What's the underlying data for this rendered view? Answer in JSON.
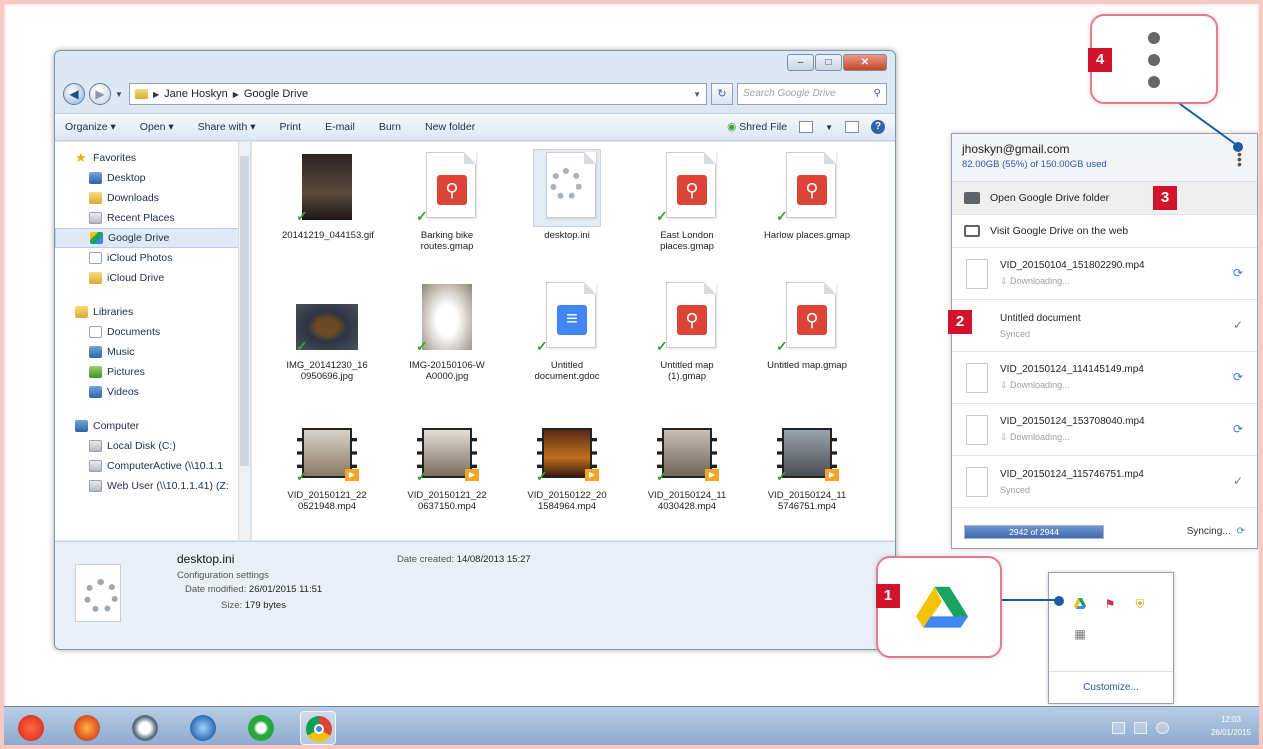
{
  "explorer": {
    "breadcrumb": [
      "Jane Hoskyn",
      "Google Drive"
    ],
    "search_placeholder": "Search Google Drive",
    "toolbar": [
      "Organize ▾",
      "Open ▾",
      "Share with ▾",
      "Print",
      "E-mail",
      "Burn",
      "New folder"
    ],
    "shred_label": "Shred File",
    "nav": {
      "favorites_label": "Favorites",
      "favorites": [
        "Desktop",
        "Downloads",
        "Recent Places",
        "Google Drive",
        "iCloud Photos",
        "iCloud Drive"
      ],
      "libraries_label": "Libraries",
      "libraries": [
        "Documents",
        "Music",
        "Pictures",
        "Videos"
      ],
      "computer_label": "Computer",
      "computer": [
        "Local Disk (C:)",
        "ComputerActive (\\\\10.1.1",
        "Web User (\\\\10.1.1.41) (Z:"
      ]
    },
    "files": [
      {
        "name": "20141219_044153.gif"
      },
      {
        "name": "Barking bike routes.gmap"
      },
      {
        "name": "desktop.ini"
      },
      {
        "name": "East London places.gmap"
      },
      {
        "name": "Harlow places.gmap"
      },
      {
        "name": "IMG_20141230_16 0950696.jpg"
      },
      {
        "name": "IMG-20150106-W A0000.jpg"
      },
      {
        "name": "Untitled document.gdoc"
      },
      {
        "name": "Untitled map (1).gmap"
      },
      {
        "name": "Untitled map.gmap"
      },
      {
        "name": "VID_20150121_22 0521948.mp4"
      },
      {
        "name": "VID_20150121_22 0637150.mp4"
      },
      {
        "name": "VID_20150122_20 1584964.mp4"
      },
      {
        "name": "VID_20150124_11 4030428.mp4"
      },
      {
        "name": "VID_20150124_11 5746751.mp4"
      }
    ],
    "details": {
      "name": "desktop.ini",
      "type": "Configuration settings",
      "modified_label": "Date modified:",
      "modified": "26/01/2015 11:51",
      "size_label": "Size:",
      "size": "179 bytes",
      "created_label": "Date created:",
      "created": "14/08/2013 15:27"
    }
  },
  "drive_popup": {
    "email": "jhoskyn@gmail.com",
    "usage": "82.00GB (55%) of 150.00GB used",
    "menu": [
      "Open Google Drive folder",
      "Visit Google Drive on the web"
    ],
    "sync_items": [
      {
        "name": "VID_20150104_151802290.mp4",
        "status": "⇩ Downloading...",
        "done": false
      },
      {
        "name": "Untitled document",
        "status": "Synced",
        "done": true
      },
      {
        "name": "VID_20150124_114145149.mp4",
        "status": "⇩ Downloading...",
        "done": false
      },
      {
        "name": "VID_20150124_153708040.mp4",
        "status": "⇩ Downloading...",
        "done": false
      },
      {
        "name": "VID_20150124_115746751.mp4",
        "status": "Synced",
        "done": true
      }
    ],
    "progress_text": "2942 of 2944",
    "progress_value": 2942,
    "progress_total": 2944,
    "sync_status": "Syncing..."
  },
  "tray": {
    "customize": "Customize..."
  },
  "callouts": [
    "1",
    "2",
    "3",
    "4"
  ],
  "clock": {
    "time": "12:03",
    "date": "26/01/2015"
  }
}
